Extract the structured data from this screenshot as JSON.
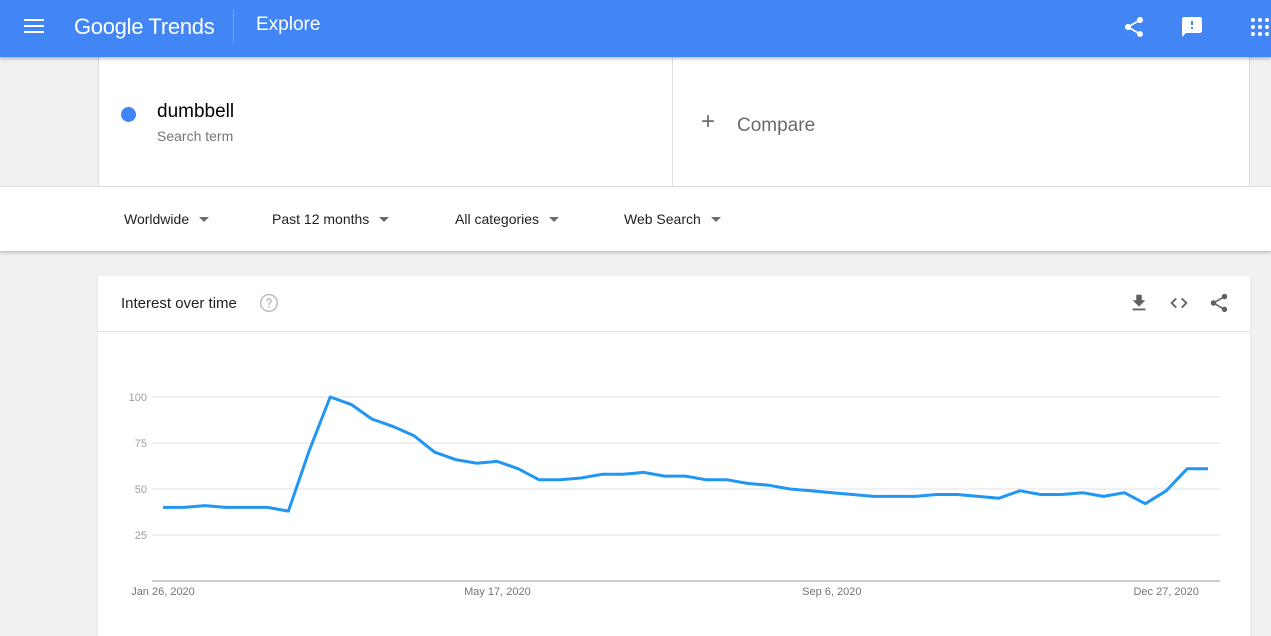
{
  "app": {
    "title": "Google Trends",
    "section": "Explore"
  },
  "header_icons": [
    "menu-icon",
    "share-icon",
    "feedback-icon",
    "apps-grid-icon"
  ],
  "search_term": {
    "name": "dumbbell",
    "type_label": "Search term",
    "color": "#4285f4"
  },
  "compare": {
    "label": "Compare",
    "icon": "plus-icon"
  },
  "filters": [
    {
      "label": "Worldwide"
    },
    {
      "label": "Past 12 months"
    },
    {
      "label": "All categories"
    },
    {
      "label": "Web Search"
    }
  ],
  "card": {
    "title": "Interest over time",
    "icons": [
      "help-icon",
      "download-icon",
      "embed-code-icon",
      "share-icon"
    ]
  },
  "chart_data": {
    "type": "line",
    "title": "Interest over time",
    "xlabel": "",
    "ylabel": "",
    "ylim": [
      0,
      100
    ],
    "yticks": [
      25,
      50,
      75,
      100
    ],
    "xtick_labels": [
      "Jan 26, 2020",
      "May 17, 2020",
      "Sep 6, 2020",
      "Dec 27, 2020"
    ],
    "xtick_indices": [
      0,
      16,
      32,
      48
    ],
    "grid": true,
    "series": [
      {
        "name": "dumbbell",
        "color": "#2196f3",
        "values": [
          40,
          40,
          41,
          40,
          40,
          40,
          38,
          71,
          100,
          96,
          88,
          84,
          79,
          70,
          66,
          64,
          65,
          61,
          55,
          55,
          56,
          58,
          58,
          59,
          57,
          57,
          55,
          55,
          53,
          52,
          50,
          49,
          48,
          47,
          46,
          46,
          46,
          47,
          47,
          46,
          45,
          49,
          47,
          47,
          48,
          46,
          48,
          42,
          49,
          61,
          61
        ]
      }
    ]
  }
}
